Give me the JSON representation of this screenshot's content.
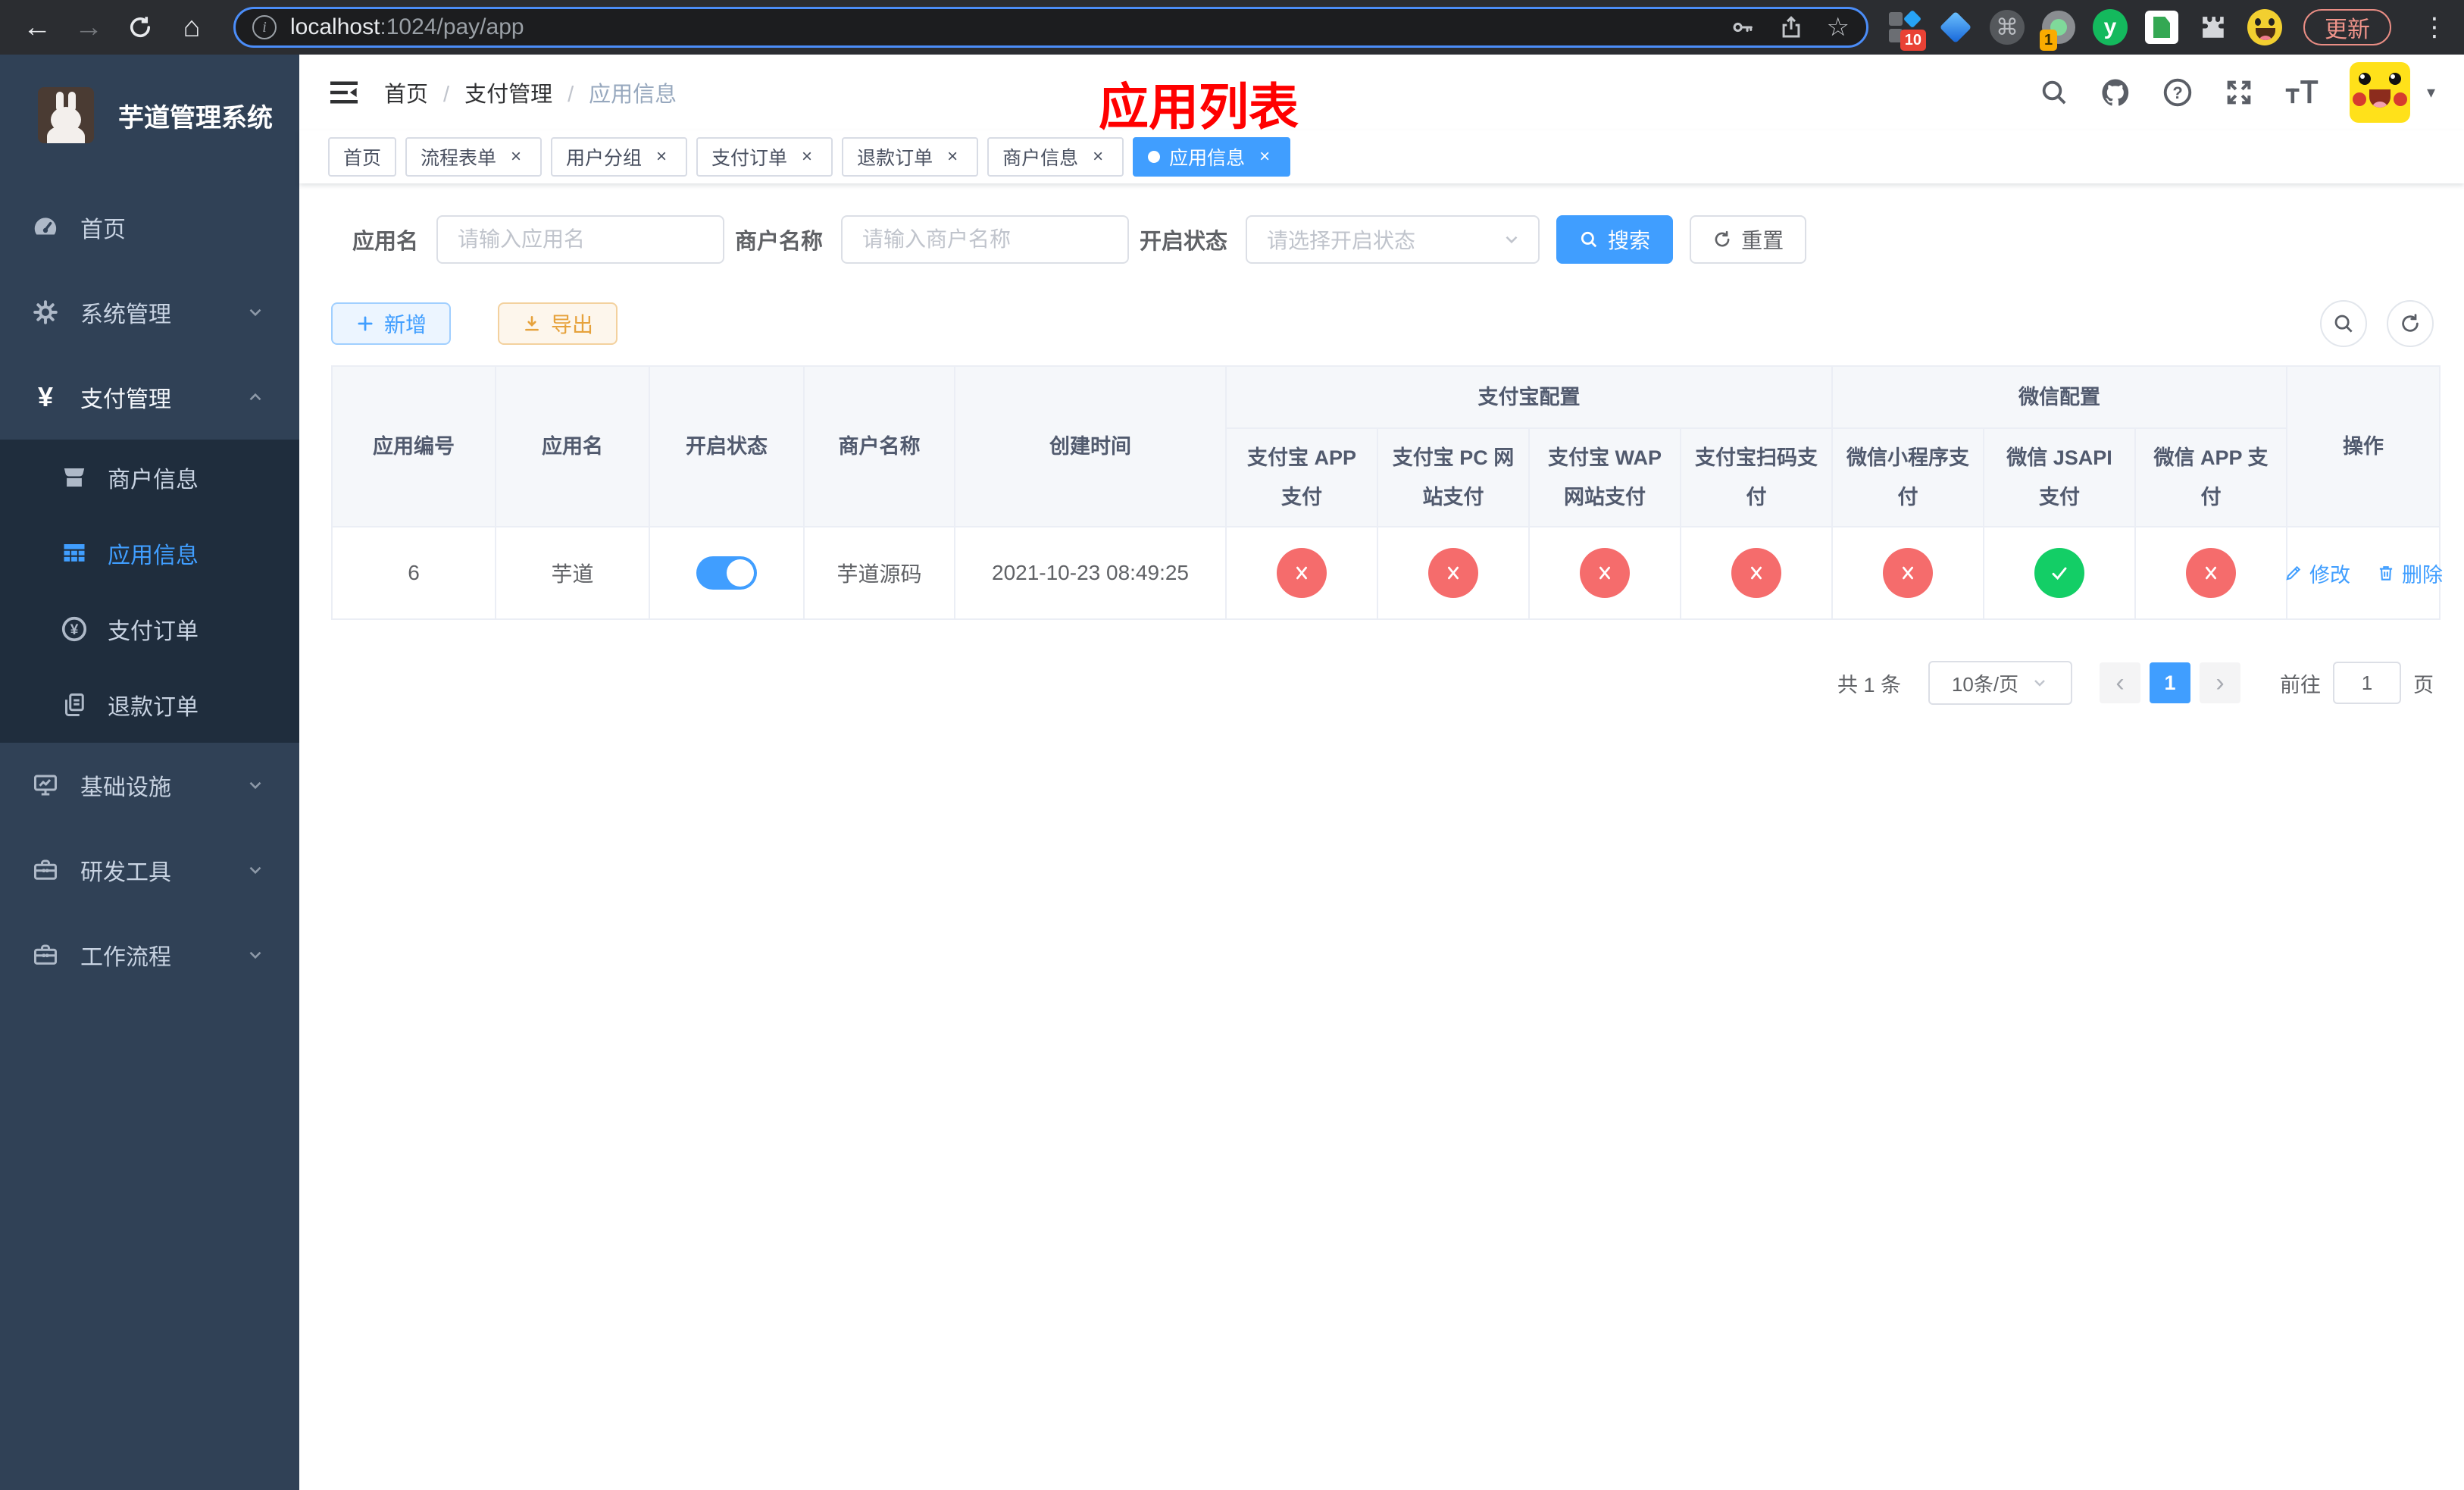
{
  "browser": {
    "url_host": "localhost",
    "url_path": ":1024/pay/app",
    "update_label": "更新",
    "ext_badges": {
      "devtools": "10",
      "proxy": "1"
    },
    "ext_y_label": "y"
  },
  "sidebar": {
    "title": "芋道管理系统",
    "items": [
      {
        "label": "首页"
      },
      {
        "label": "系统管理"
      },
      {
        "label": "支付管理",
        "children": [
          {
            "label": "商户信息"
          },
          {
            "label": "应用信息"
          },
          {
            "label": "支付订单"
          },
          {
            "label": "退款订单"
          }
        ]
      },
      {
        "label": "基础设施"
      },
      {
        "label": "研发工具"
      },
      {
        "label": "工作流程"
      }
    ]
  },
  "header": {
    "breadcrumb": [
      "首页",
      "支付管理",
      "应用信息"
    ],
    "annotation": "应用列表"
  },
  "tabs": [
    {
      "label": "首页"
    },
    {
      "label": "流程表单"
    },
    {
      "label": "用户分组"
    },
    {
      "label": "支付订单"
    },
    {
      "label": "退款订单"
    },
    {
      "label": "商户信息"
    },
    {
      "label": "应用信息"
    }
  ],
  "filters": {
    "app_name_label": "应用名",
    "app_name_placeholder": "请输入应用名",
    "merchant_label": "商户名称",
    "merchant_placeholder": "请输入商户名称",
    "status_label": "开启状态",
    "status_placeholder": "请选择开启状态",
    "search_label": "搜索",
    "reset_label": "重置"
  },
  "toolbar": {
    "add_label": "新增",
    "export_label": "导出"
  },
  "table": {
    "columns": [
      "应用编号",
      "应用名",
      "开启状态",
      "商户名称",
      "创建时间"
    ],
    "groups": {
      "alipay": "支付宝配置",
      "wechat": "微信配置"
    },
    "channel_columns": [
      "支付宝 APP 支付",
      "支付宝 PC 网站支付",
      "支付宝 WAP 网站支付",
      "支付宝扫码支付",
      "微信小程序支付",
      "微信 JSAPI 支付",
      "微信 APP 支付"
    ],
    "actions_column": "操作",
    "rows": [
      {
        "id": "6",
        "name": "芋道",
        "enabled": true,
        "merchant": "芋道源码",
        "created_at": "2021-10-23 08:49:25",
        "channel_status": [
          false,
          false,
          false,
          false,
          false,
          true,
          false
        ],
        "edit_label": "修改",
        "delete_label": "删除"
      }
    ]
  },
  "pagination": {
    "total": "共 1 条",
    "page_size": "10条/页",
    "current_page": "1",
    "goto_label": "前往",
    "goto_value": "1",
    "unit_label": "页"
  },
  "colors": {
    "accent": "#409eff",
    "danger": "#f56c6c",
    "success": "#13ce66",
    "warning": "#e6a23c",
    "sidebar_bg": "#304156",
    "submenu_bg": "#1f2d3d",
    "annotation": "#ff0000"
  }
}
